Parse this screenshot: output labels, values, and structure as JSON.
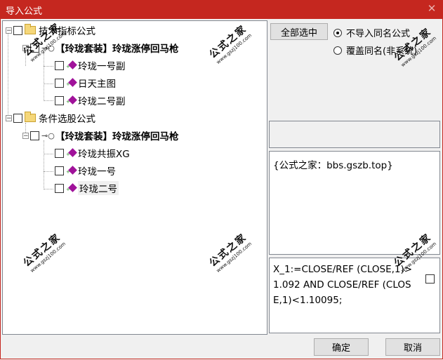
{
  "window": {
    "title": "导入公式",
    "close_glyph": "✕"
  },
  "tree": {
    "groups": [
      {
        "label": "技术指标公式",
        "suite_label": "【玲珑套装】玲珑涨停回马枪",
        "items": [
          "玲珑一号副",
          "日天主图",
          "玲珑二号副"
        ]
      },
      {
        "label": "条件选股公式",
        "suite_label": "【玲珑套装】玲珑涨停回马枪",
        "items": [
          "玲珑共振XG",
          "玲珑一号",
          "玲珑二号"
        ]
      }
    ]
  },
  "controls": {
    "select_all": "全部选中",
    "radio_skip_same": "不导入同名公式",
    "radio_overwrite": "覆盖同名(非系统)",
    "selected_radio": "skip_same"
  },
  "info": {
    "text": "{公式之家：bbs.gszb.top}"
  },
  "formula": {
    "text": "X_1:=CLOSE/REF (CLOSE,1)>1.092 AND CLOSE/REF (CLOSE,1)<1.10095;"
  },
  "footer": {
    "ok": "确定",
    "cancel": "取消"
  },
  "watermark": {
    "title": "公式之家",
    "site": "www.gszj100.com"
  },
  "colors": {
    "title_bar": "#c5271f",
    "item_icon": "#a0129a"
  }
}
